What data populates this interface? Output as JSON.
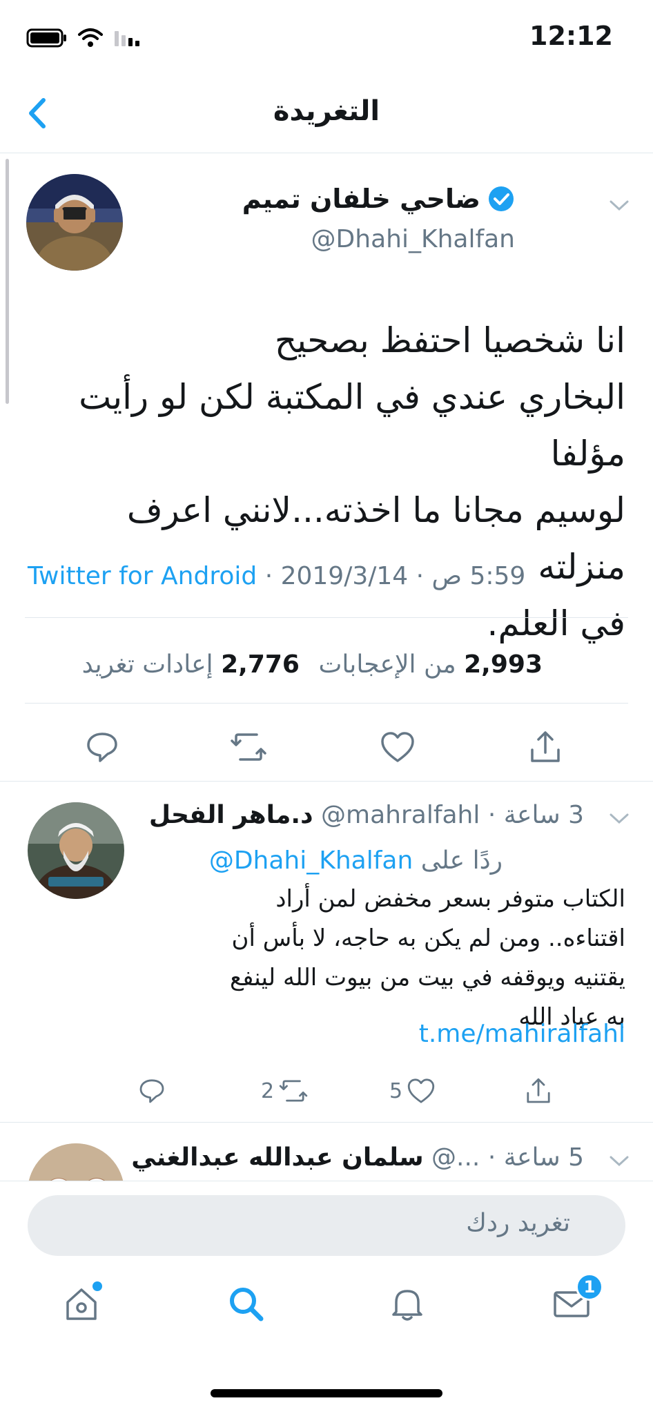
{
  "status_bar": {
    "time": "12:12"
  },
  "header": {
    "title": "التغريدة"
  },
  "tweet": {
    "author_name": "ضاحي خلفان تميم",
    "handle": "@Dhahi_Khalfan",
    "text": "انا شخصيا احتفظ بصحيح\nالبخاري عندي في المكتبة لكن لو رأيت مؤلفا\nلوسيم مجانا ما اخذته...لانني اعرف منزلته\nفي العلم.",
    "source": "Twitter for Android",
    "date": "2019/3/14",
    "time": "5:59 ص",
    "likes_count": "2,993",
    "likes_label": "من الإعجابات",
    "retweets_count": "2,776",
    "retweets_label": "إعادات تغريد"
  },
  "reply": {
    "name": "د.ماهر الفحل",
    "handle": "@mahralfahl",
    "time": "3 ساعة",
    "replying_label": "ردًا على",
    "replying_to": "@Dhahi_Khalfan",
    "text": "الكتاب متوفر بسعر مخفض لمن أراد\nاقتناءه.. ومن لم يكن به حاجه، لا بأس أن\nيقتنيه ويوقفه في بيت من بيوت الله لينفع\nبه عباد الله",
    "link": "t.me/mahiralfahl",
    "retweets": "2",
    "likes": "5"
  },
  "next_reply": {
    "name": "سلمان عبدالله عبدالغني",
    "handle": "@...",
    "time": "5 ساعة"
  },
  "compose": {
    "placeholder": "تغريد ردك"
  },
  "tabbar": {
    "messages_badge": "1"
  },
  "colors": {
    "accent": "#1da1f2",
    "secondary_text": "#657786",
    "divider": "#e1e8ed"
  }
}
